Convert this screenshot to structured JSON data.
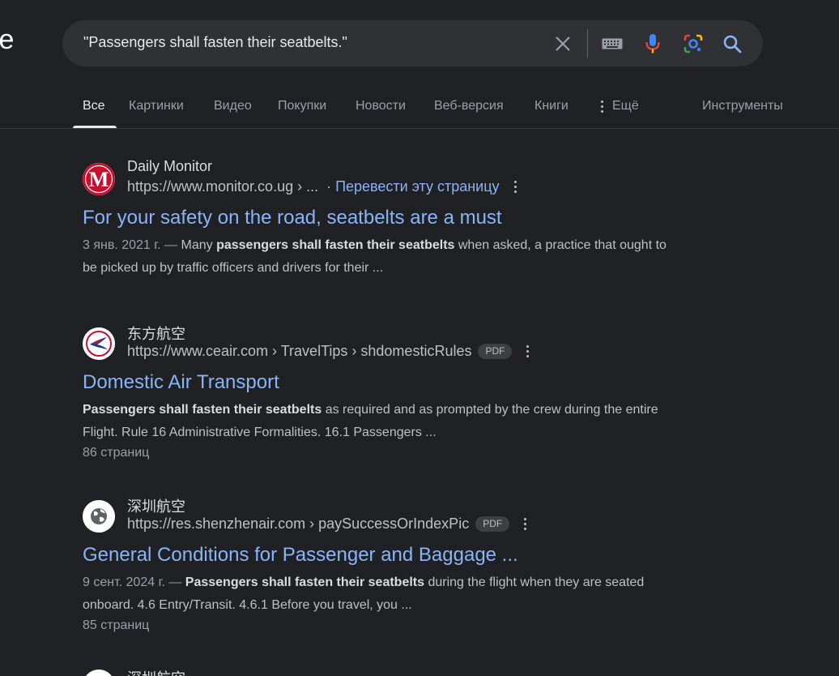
{
  "logo_fragment": "le",
  "search": {
    "query": "\"Passengers shall fasten their seatbelts.\""
  },
  "icons": {
    "clear": "close-icon",
    "keyboard": "keyboard-icon",
    "voice": "microphone-icon",
    "lens": "lens-camera-icon",
    "search": "search-icon"
  },
  "colors": {
    "background": "#202124",
    "link": "#8ab4f8",
    "mic_blue": "#4285f4",
    "mic_red": "#ea4335"
  },
  "tabs": [
    {
      "label": "Все",
      "active": true
    },
    {
      "label": "Картинки"
    },
    {
      "label": "Видео"
    },
    {
      "label": "Покупки"
    },
    {
      "label": "Новости"
    },
    {
      "label": "Веб-версия"
    },
    {
      "label": "Книги"
    },
    {
      "label": "Ещё"
    }
  ],
  "tools_label": "Инструменты",
  "results": [
    {
      "site_name": "Daily Monitor",
      "url": "https://www.monitor.co.ug › ...",
      "translate": "· Перевести эту страницу",
      "title": "For your safety on the road, seatbelts are a must",
      "snippet_date": "3 янв. 2021 г. — ",
      "snippet_pre": "Many ",
      "snippet_bold": "passengers shall fasten their seatbelts",
      "snippet_post": " when asked, a practice that ought to be picked up by traffic officers and drivers for their ..."
    },
    {
      "site_name": "东方航空",
      "url": "https://www.ceair.com › TravelTips › shdomesticRules",
      "badge": "PDF",
      "title": "Domestic Air Transport",
      "snippet_bold": "Passengers shall fasten their seatbelts",
      "snippet_post": " as required and as prompted by the crew during the entire Flight. Rule 16 Administrative Formalities. 16.1 Passengers ...",
      "pages": "86 страниц"
    },
    {
      "site_name": "深圳航空",
      "url": "https://res.shenzhenair.com › paySuccessOrIndexPic",
      "badge": "PDF",
      "title": "General Conditions for Passenger and Baggage ...",
      "snippet_date": "9 сент. 2024 г. — ",
      "snippet_bold": "Passengers shall fasten their seatbelts",
      "snippet_post": " during the flight when they are seated onboard. 4.6 Entry/Transit. 4.6.1 Before you travel, you ...",
      "pages": "85 страниц"
    }
  ],
  "partial_site_name": "深圳航空"
}
